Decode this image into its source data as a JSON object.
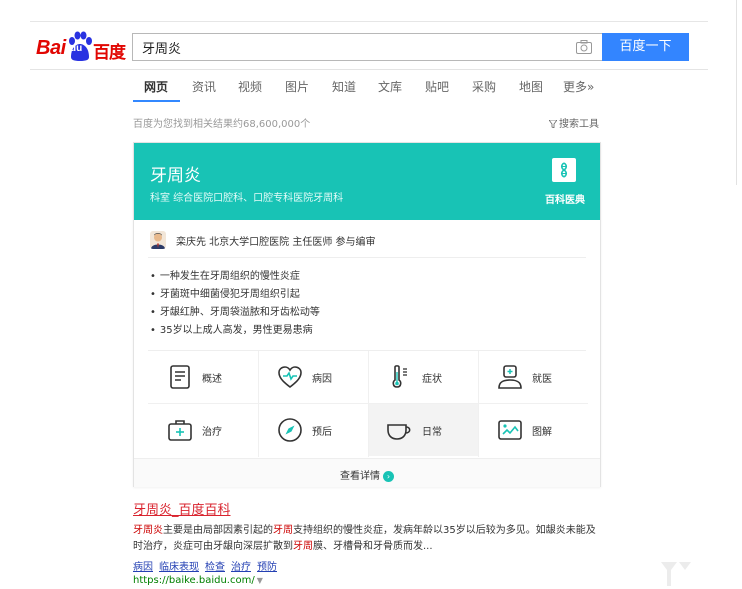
{
  "header": {
    "logo_text_en": "Bai",
    "logo_text_du": "du",
    "logo_text_cn": "百度",
    "search_value": "牙周炎",
    "search_button": "百度一下"
  },
  "nav": {
    "items": [
      {
        "label": "网页",
        "active": true
      },
      {
        "label": "资讯"
      },
      {
        "label": "视频"
      },
      {
        "label": "图片"
      },
      {
        "label": "知道"
      },
      {
        "label": "文库"
      },
      {
        "label": "贴吧"
      },
      {
        "label": "采购"
      },
      {
        "label": "地图"
      },
      {
        "label": "更多»"
      }
    ]
  },
  "results_meta": {
    "count_text": "百度为您找到相关结果约68,600,000个",
    "tools_label": "搜索工具"
  },
  "card": {
    "title": "牙周炎",
    "subtitle": "科室  综合医院口腔科、口腔专科医院牙周科",
    "brand": "百科医典",
    "expert": "栾庆先  北京大学口腔医院 主任医师 参与编审",
    "bullets": [
      "一种发生在牙周组织的慢性炎症",
      "牙菌斑中细菌侵犯牙周组织引起",
      "牙龈红肿、牙周袋溢脓和牙齿松动等",
      "35岁以上成人高发，男性更易患病"
    ],
    "grid": [
      {
        "label": "概述",
        "icon": "document-icon"
      },
      {
        "label": "病因",
        "icon": "heart-pulse-icon"
      },
      {
        "label": "症状",
        "icon": "thermometer-icon"
      },
      {
        "label": "就医",
        "icon": "doctor-icon"
      },
      {
        "label": "治疗",
        "icon": "medical-kit-icon"
      },
      {
        "label": "预后",
        "icon": "compass-icon"
      },
      {
        "label": "日常",
        "icon": "cup-icon"
      },
      {
        "label": "图解",
        "icon": "image-icon"
      }
    ],
    "more_label": "查看详情"
  },
  "result": {
    "title": "牙周炎_百度百科",
    "abstract_parts": [
      {
        "text": "牙周炎",
        "hl": true
      },
      {
        "text": "主要是由局部因素引起的"
      },
      {
        "text": "牙周",
        "hl": true
      },
      {
        "text": "支持组织的慢性炎症，发病年龄以35岁以后较为多见。如龈炎未能及时治疗，炎症可由牙龈向深层扩散到"
      },
      {
        "text": "牙周",
        "hl": true
      },
      {
        "text": "膜、牙槽骨和牙骨质而发..."
      }
    ],
    "links": [
      "病因",
      "临床表现",
      "检查",
      "治疗",
      "预防"
    ],
    "url": "https://baike.baidu.com/"
  },
  "colors": {
    "brand_red": "#e10602",
    "baidu_blue": "#3385ff",
    "card_teal": "#18c3b5",
    "link_blue": "#2440b3",
    "url_green": "#008000"
  }
}
